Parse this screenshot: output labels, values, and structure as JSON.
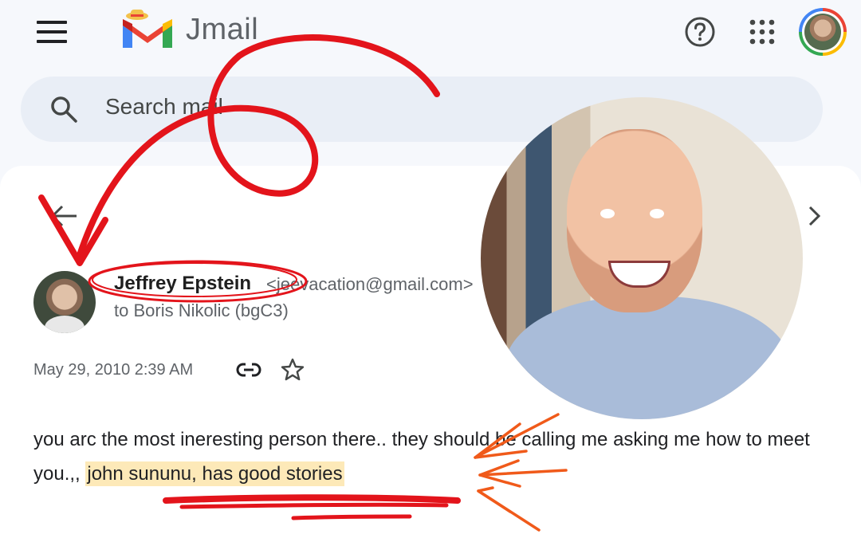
{
  "app": {
    "name": "Jmail"
  },
  "header": {
    "menu_icon": "menu-icon",
    "help_icon": "help-icon",
    "apps_icon": "apps-grid-icon",
    "avatar_icon": "account-avatar"
  },
  "search": {
    "placeholder": "Search mail"
  },
  "email": {
    "sender_name": "Jeffrey Epstein",
    "sender_email": "<jeevacation@gmail.com>",
    "recipient": "to Boris Nikolic (bgC3)",
    "date": "May 29, 2010 2:39 AM",
    "body_before": "you arc the most ineresting person there.. they should be calling me asking me how to meet you.,, ",
    "body_highlight": "john sununu, has good stories"
  },
  "colors": {
    "annotation_red": "#e3141b",
    "annotation_orange": "#f05a1a",
    "highlight": "#fde9b8"
  }
}
